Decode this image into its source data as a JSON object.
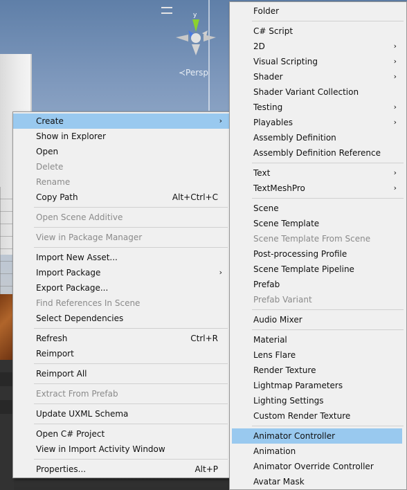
{
  "scene": {
    "persp_label": "≺Persp",
    "gizmo_axis_label": "y"
  },
  "context_menu": {
    "items": [
      {
        "label": "Create",
        "enabled": true,
        "highlighted": true,
        "has_submenu": true
      },
      {
        "label": "Show in Explorer",
        "enabled": true
      },
      {
        "label": "Open",
        "enabled": true
      },
      {
        "label": "Delete",
        "enabled": false
      },
      {
        "label": "Rename",
        "enabled": false
      },
      {
        "label": "Copy Path",
        "enabled": true,
        "shortcut": "Alt+Ctrl+C"
      },
      {
        "label": "Open Scene Additive",
        "enabled": false
      },
      {
        "label": "View in Package Manager",
        "enabled": false
      },
      {
        "label": "Import New Asset...",
        "enabled": true
      },
      {
        "label": "Import Package",
        "enabled": true,
        "has_submenu": true
      },
      {
        "label": "Export Package...",
        "enabled": true
      },
      {
        "label": "Find References In Scene",
        "enabled": false
      },
      {
        "label": "Select Dependencies",
        "enabled": true
      },
      {
        "label": "Refresh",
        "enabled": true,
        "shortcut": "Ctrl+R"
      },
      {
        "label": "Reimport",
        "enabled": true
      },
      {
        "label": "Reimport All",
        "enabled": true
      },
      {
        "label": "Extract From Prefab",
        "enabled": false
      },
      {
        "label": "Update UXML Schema",
        "enabled": true
      },
      {
        "label": "Open C# Project",
        "enabled": true
      },
      {
        "label": "View in Import Activity Window",
        "enabled": true
      },
      {
        "label": "Properties...",
        "enabled": true,
        "shortcut": "Alt+P"
      }
    ]
  },
  "create_submenu": {
    "items": [
      {
        "label": "Folder",
        "enabled": true
      },
      {
        "label": "C# Script",
        "enabled": true
      },
      {
        "label": "2D",
        "enabled": true,
        "has_submenu": true
      },
      {
        "label": "Visual Scripting",
        "enabled": true,
        "has_submenu": true
      },
      {
        "label": "Shader",
        "enabled": true,
        "has_submenu": true
      },
      {
        "label": "Shader Variant Collection",
        "enabled": true
      },
      {
        "label": "Testing",
        "enabled": true,
        "has_submenu": true
      },
      {
        "label": "Playables",
        "enabled": true,
        "has_submenu": true
      },
      {
        "label": "Assembly Definition",
        "enabled": true
      },
      {
        "label": "Assembly Definition Reference",
        "enabled": true
      },
      {
        "label": "Text",
        "enabled": true,
        "has_submenu": true
      },
      {
        "label": "TextMeshPro",
        "enabled": true,
        "has_submenu": true
      },
      {
        "label": "Scene",
        "enabled": true
      },
      {
        "label": "Scene Template",
        "enabled": true
      },
      {
        "label": "Scene Template From Scene",
        "enabled": false
      },
      {
        "label": "Post-processing Profile",
        "enabled": true
      },
      {
        "label": "Scene Template Pipeline",
        "enabled": true
      },
      {
        "label": "Prefab",
        "enabled": true
      },
      {
        "label": "Prefab Variant",
        "enabled": false
      },
      {
        "label": "Audio Mixer",
        "enabled": true
      },
      {
        "label": "Material",
        "enabled": true
      },
      {
        "label": "Lens Flare",
        "enabled": true
      },
      {
        "label": "Render Texture",
        "enabled": true
      },
      {
        "label": "Lightmap Parameters",
        "enabled": true
      },
      {
        "label": "Lighting Settings",
        "enabled": true
      },
      {
        "label": "Custom Render Texture",
        "enabled": true
      },
      {
        "label": "Animator Controller",
        "enabled": true,
        "highlighted": true
      },
      {
        "label": "Animation",
        "enabled": true
      },
      {
        "label": "Animator Override Controller",
        "enabled": true
      },
      {
        "label": "Avatar Mask",
        "enabled": true
      }
    ]
  },
  "icons": {
    "submenu_arrow": "chevron-right-icon"
  },
  "colors": {
    "menu_bg": "#f0f0f0",
    "highlight": "#99c9ef",
    "disabled_text": "#8a8a8a"
  }
}
